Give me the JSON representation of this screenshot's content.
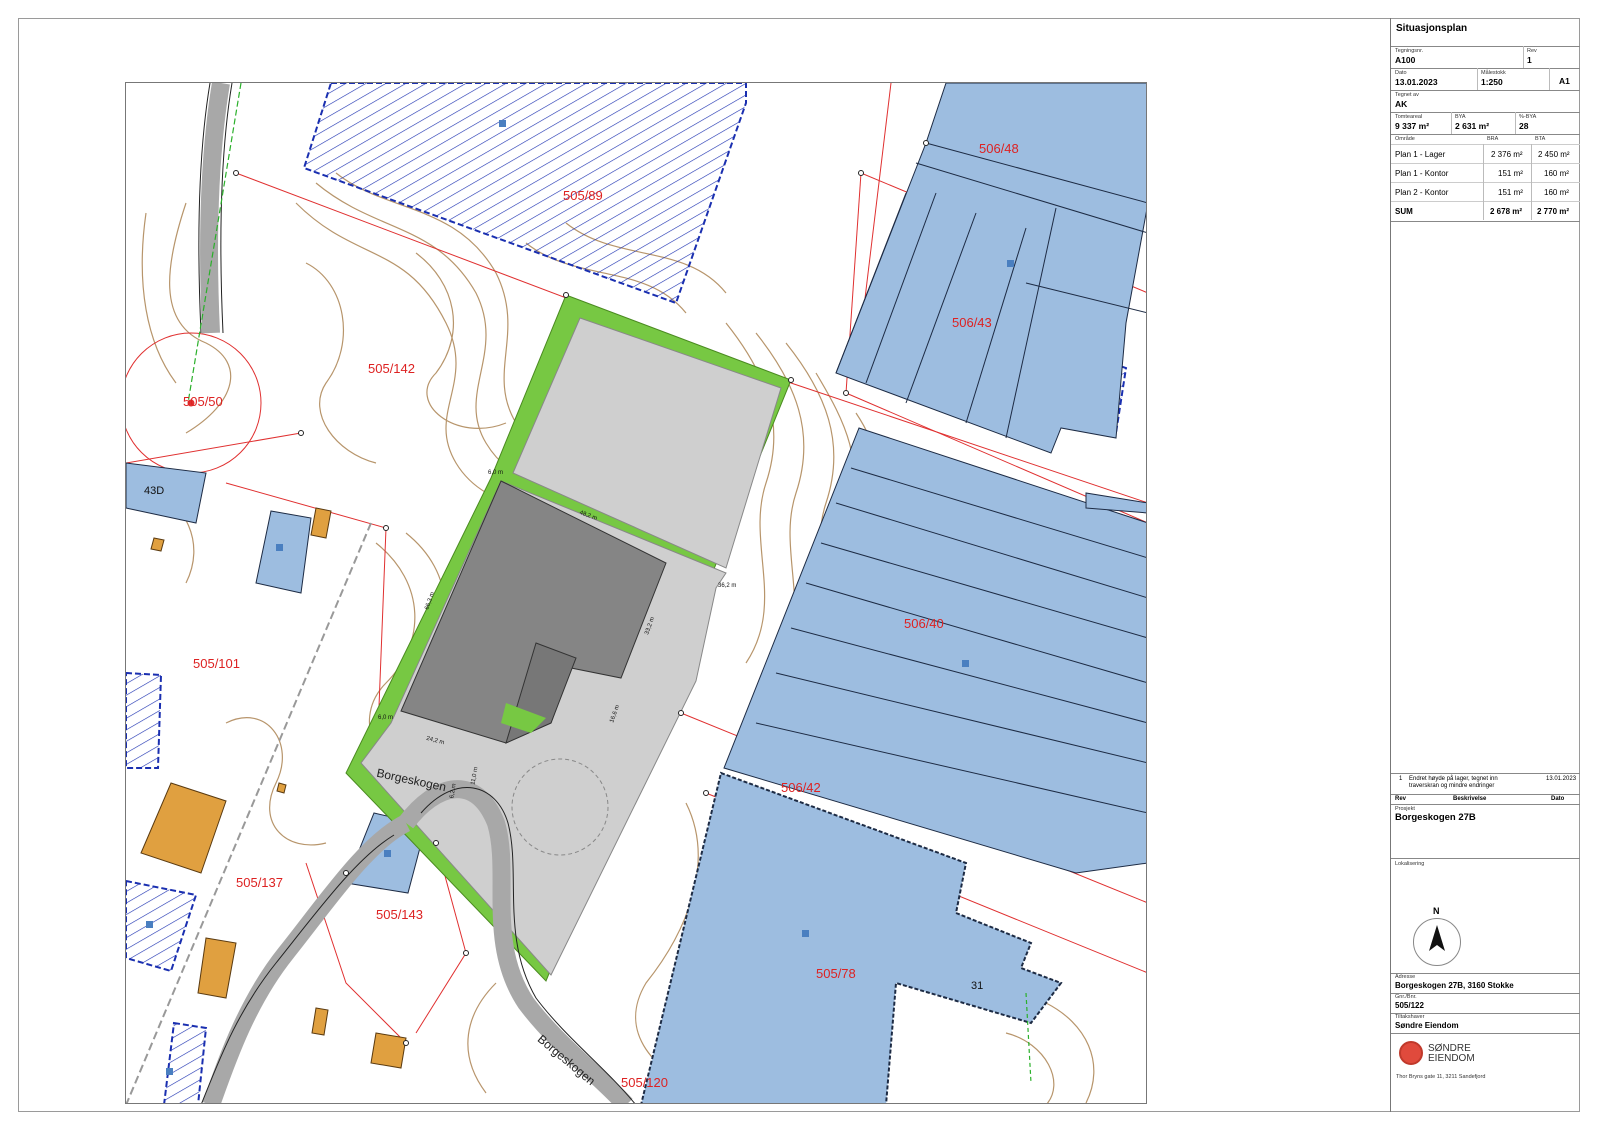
{
  "title_block": {
    "sheet_title": "Situasjonsplan",
    "drawing_number": {
      "label": "Tegningsnr.",
      "value": "A100"
    },
    "revision": {
      "label": "Rev",
      "value": "1"
    },
    "date": {
      "label": "Dato",
      "value": "13.01.2023"
    },
    "scale": {
      "label": "Målestokk",
      "value": "1:250"
    },
    "paper_size": "A1",
    "drawn_by": {
      "label": "Tegnet av",
      "value": "AK"
    },
    "site_area": {
      "label": "Tomteareal",
      "value": "9 337 m²"
    },
    "bya": {
      "label": "BYA",
      "value": "2 631 m²"
    },
    "pct_bya": {
      "label": "%-BYA",
      "value": "28"
    },
    "area_table": {
      "headers": [
        "Område",
        "BRA",
        "BTA"
      ],
      "rows": [
        {
          "name": "Plan 1 - Lager",
          "bra": "2 376 m²",
          "bta": "2 450 m²"
        },
        {
          "name": "Plan 1 - Kontor",
          "bra": "151 m²",
          "bta": "160 m²"
        },
        {
          "name": "Plan 2 - Kontor",
          "bra": "151 m²",
          "bta": "160 m²"
        },
        {
          "name": "SUM",
          "bra": "2 678 m²",
          "bta": "2 770 m²"
        }
      ]
    },
    "revision_log": {
      "entries": [
        {
          "rev": "1",
          "description": "Endret høyde på lager, tegnet inn traverskran og mindre endringer",
          "date": "13.01.2023"
        }
      ],
      "headers": [
        "Rev",
        "Beskrivelse",
        "Dato"
      ]
    },
    "project": {
      "label": "Prosjekt",
      "value": "Borgeskogen 27B"
    },
    "location_label": "Lokalisering",
    "north_label": "N",
    "address": {
      "label": "Adresse",
      "value": "Borgeskogen 27B, 3160 Stokke"
    },
    "gnr_bnr": {
      "label": "Gnr./Bnr.",
      "value": "505/122"
    },
    "client": {
      "label": "Tiltakshaver",
      "value": "Søndre Eiendom"
    },
    "logo_text_line1": "SØNDRE",
    "logo_text_line2": "EIENDOM",
    "footer_address": "Thor Bryns gate 11, 3211 Sandefjord"
  },
  "map": {
    "parcel_labels": [
      "505/89",
      "506/48",
      "506/43",
      "505/142",
      "505/50",
      "43D",
      "506/40",
      "505/101",
      "506/42",
      "505/137",
      "505/143",
      "505/78",
      "31",
      "505/120"
    ],
    "road_name": "Borgeskogen",
    "dimensions": [
      "6,0 m",
      "48,2 m",
      "36,2 m",
      "66,3 m",
      "33,2 m",
      "16,6 m",
      "6,0 m",
      "24,2 m",
      "11,0 m",
      "6,2 m"
    ],
    "colors": {
      "parcel_line": "#e03030",
      "contour": "#b08a5c",
      "existing_building": "#9dbde0",
      "hatched_building": "#1a2fb0",
      "new_building": "#8a8a8a",
      "green_area": "#77c843",
      "paved_area": "#cfcfcf",
      "garage": "#e0a040"
    }
  }
}
